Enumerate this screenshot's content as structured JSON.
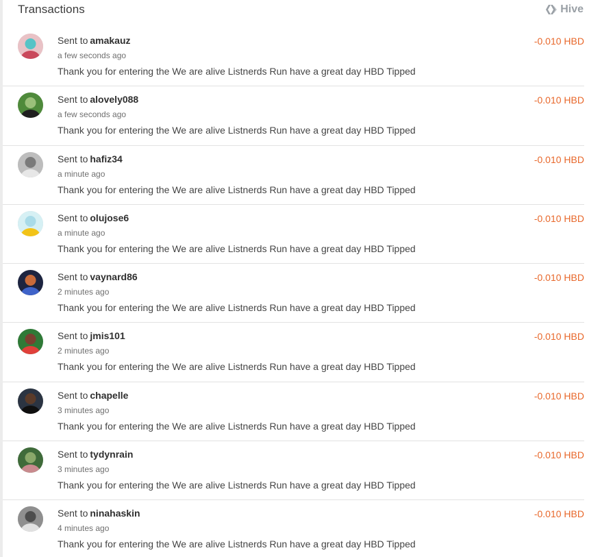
{
  "header": {
    "title": "Transactions",
    "network_label": "Hive",
    "network_icon": "hive-icon"
  },
  "colors": {
    "amount": "#e8672a",
    "title": "#3c3c3c",
    "muted": "#9aa0a6"
  },
  "transactions": [
    {
      "prefix": "Sent to",
      "user": "amakauz",
      "time": "a few seconds ago",
      "memo": "Thank you for entering the We are alive Listnerds Run have a great day HBD Tipped",
      "amount": "-0.010 HBD",
      "avatar_colors": [
        "#e9c2c6",
        "#c9485b",
        "#57c3c6"
      ]
    },
    {
      "prefix": "Sent to",
      "user": "alovely088",
      "time": "a few seconds ago",
      "memo": "Thank you for entering the We are alive Listnerds Run have a great day HBD Tipped",
      "amount": "-0.010 HBD",
      "avatar_colors": [
        "#4f8a3b",
        "#1f1f1f",
        "#9bc07a"
      ]
    },
    {
      "prefix": "Sent to",
      "user": "hafiz34",
      "time": "a minute ago",
      "memo": "Thank you for entering the We are alive Listnerds Run have a great day HBD Tipped",
      "amount": "-0.010 HBD",
      "avatar_colors": [
        "#bdbdbd",
        "#e7e7e7",
        "#7a7a7a"
      ]
    },
    {
      "prefix": "Sent to",
      "user": "olujose6",
      "time": "a minute ago",
      "memo": "Thank you for entering the We are alive Listnerds Run have a great day HBD Tipped",
      "amount": "-0.010 HBD",
      "avatar_colors": [
        "#d6f0f4",
        "#f2c318",
        "#a9dbe8"
      ]
    },
    {
      "prefix": "Sent to",
      "user": "vaynard86",
      "time": "2 minutes ago",
      "memo": "Thank you for entering the We are alive Listnerds Run have a great day HBD Tipped",
      "amount": "-0.010 HBD",
      "avatar_colors": [
        "#1d2440",
        "#3f63c9",
        "#c86a3a"
      ]
    },
    {
      "prefix": "Sent to",
      "user": "jmis101",
      "time": "2 minutes ago",
      "memo": "Thank you for entering the We are alive Listnerds Run have a great day HBD Tipped",
      "amount": "-0.010 HBD",
      "avatar_colors": [
        "#2f7a37",
        "#e0403a",
        "#7a4030"
      ]
    },
    {
      "prefix": "Sent to",
      "user": "chapelle",
      "time": "3 minutes ago",
      "memo": "Thank you for entering the We are alive Listnerds Run have a great day HBD Tipped",
      "amount": "-0.010 HBD",
      "avatar_colors": [
        "#2b3442",
        "#0f0f0f",
        "#5a3b2a"
      ]
    },
    {
      "prefix": "Sent to",
      "user": "tydynrain",
      "time": "3 minutes ago",
      "memo": "Thank you for entering the We are alive Listnerds Run have a great day HBD Tipped",
      "amount": "-0.010 HBD",
      "avatar_colors": [
        "#3f6b3a",
        "#c98a8e",
        "#8aa86a"
      ]
    },
    {
      "prefix": "Sent to",
      "user": "ninahaskin",
      "time": "4 minutes ago",
      "memo": "Thank you for entering the We are alive Listnerds Run have a great day HBD Tipped",
      "amount": "-0.010 HBD",
      "avatar_colors": [
        "#8f8f8f",
        "#e1e1e1",
        "#4d4d4d"
      ]
    }
  ]
}
